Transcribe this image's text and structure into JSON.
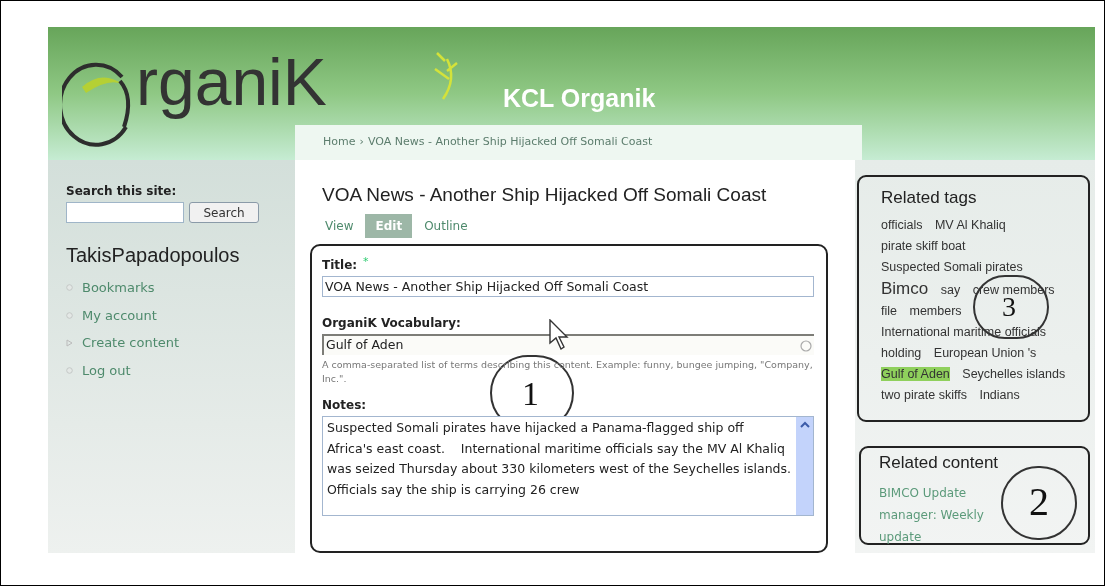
{
  "header": {
    "logo_text": "rganiK",
    "site_name": "KCL Organik"
  },
  "breadcrumb": {
    "items": [
      "Home",
      "VOA News - Another Ship Hijacked Off Somali Coast"
    ],
    "separator": "›"
  },
  "sidebar": {
    "search_label": "Search this site:",
    "search_button": "Search",
    "user_name": "TakisPapadopoulos",
    "items": [
      {
        "label": "Bookmarks",
        "kind": "leaf"
      },
      {
        "label": "My account",
        "kind": "leaf"
      },
      {
        "label": "Create content",
        "kind": "collapsed"
      },
      {
        "label": "Log out",
        "kind": "leaf"
      }
    ]
  },
  "content": {
    "title": "VOA News - Another Ship Hijacked Off Somali Coast",
    "tabs": [
      {
        "label": "View",
        "selected": false
      },
      {
        "label": "Edit",
        "selected": true
      },
      {
        "label": "Outline",
        "selected": false
      }
    ],
    "form": {
      "annotation": "1",
      "title_label": "Title:",
      "required_mark": "*",
      "title_value": "VOA News - Another Ship Hijacked Off Somali Coast",
      "vocabulary_label": "OrganiK Vocabulary:",
      "vocabulary_value": "Gulf of Aden",
      "vocabulary_help": "A comma-separated list of terms describing this content. Example: funny, bungee jumping, \"Company, Inc.\".",
      "notes_label": "Notes:",
      "notes_value": "Suspected Somali pirates have hijacked a Panama-flagged ship off Africa's east coast.    International maritime officials say the MV Al Khaliq was seized Thursday about 330 kilometers west of the Seychelles islands.      Officials say the ship is carrying 26 crew"
    }
  },
  "related_tags": {
    "annotation": "3",
    "title": "Related tags",
    "tags": [
      {
        "label": "officials",
        "kind": "normal",
        "highlighted": false
      },
      {
        "label": "MV Al Khaliq",
        "kind": "normal",
        "highlighted": false
      },
      {
        "label": "pirate skiff boat",
        "kind": "normal",
        "highlighted": false
      },
      {
        "label": "Suspected Somali pirates",
        "kind": "normal",
        "highlighted": false
      },
      {
        "label": "Bimco",
        "kind": "large",
        "highlighted": false
      },
      {
        "label": "say",
        "kind": "normal",
        "highlighted": false
      },
      {
        "label": "crew members",
        "kind": "normal",
        "highlighted": false
      },
      {
        "label": "file",
        "kind": "normal",
        "highlighted": false
      },
      {
        "label": "members",
        "kind": "normal",
        "highlighted": false
      },
      {
        "label": "International maritime officials",
        "kind": "normal",
        "highlighted": false
      },
      {
        "label": "holding",
        "kind": "normal",
        "highlighted": false
      },
      {
        "label": "European Union 's",
        "kind": "normal",
        "highlighted": false
      },
      {
        "label": "Gulf of Aden",
        "kind": "normal",
        "highlighted": true
      },
      {
        "label": "Seychelles islands",
        "kind": "normal",
        "highlighted": false
      },
      {
        "label": "two pirate skiffs",
        "kind": "normal",
        "highlighted": false
      },
      {
        "label": "Indians",
        "kind": "normal",
        "highlighted": false
      }
    ]
  },
  "related_content": {
    "annotation": "2",
    "title": "Related content",
    "links": [
      "BIMCO Update manager: Weekly update"
    ]
  }
}
